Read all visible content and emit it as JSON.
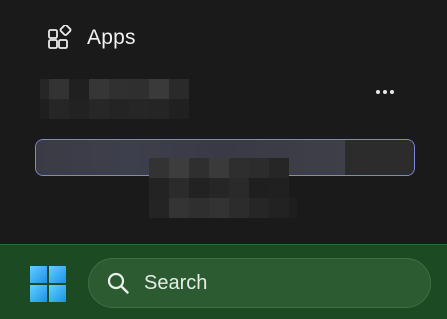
{
  "start_menu": {
    "apps_label": "Apps",
    "apps_icon": "apps-grid-icon",
    "more_icon": "more-ellipsis-icon"
  },
  "taskbar": {
    "start_icon": "windows-logo-icon",
    "search_icon": "search-icon",
    "search_label": "Search"
  },
  "colors": {
    "panel_background": "#1a1a1a",
    "taskbar_background": "#1c4a23",
    "search_box": "#2c5a31",
    "focus_outline": "#7f86d7",
    "windows_logo": "#3fb5ff"
  }
}
